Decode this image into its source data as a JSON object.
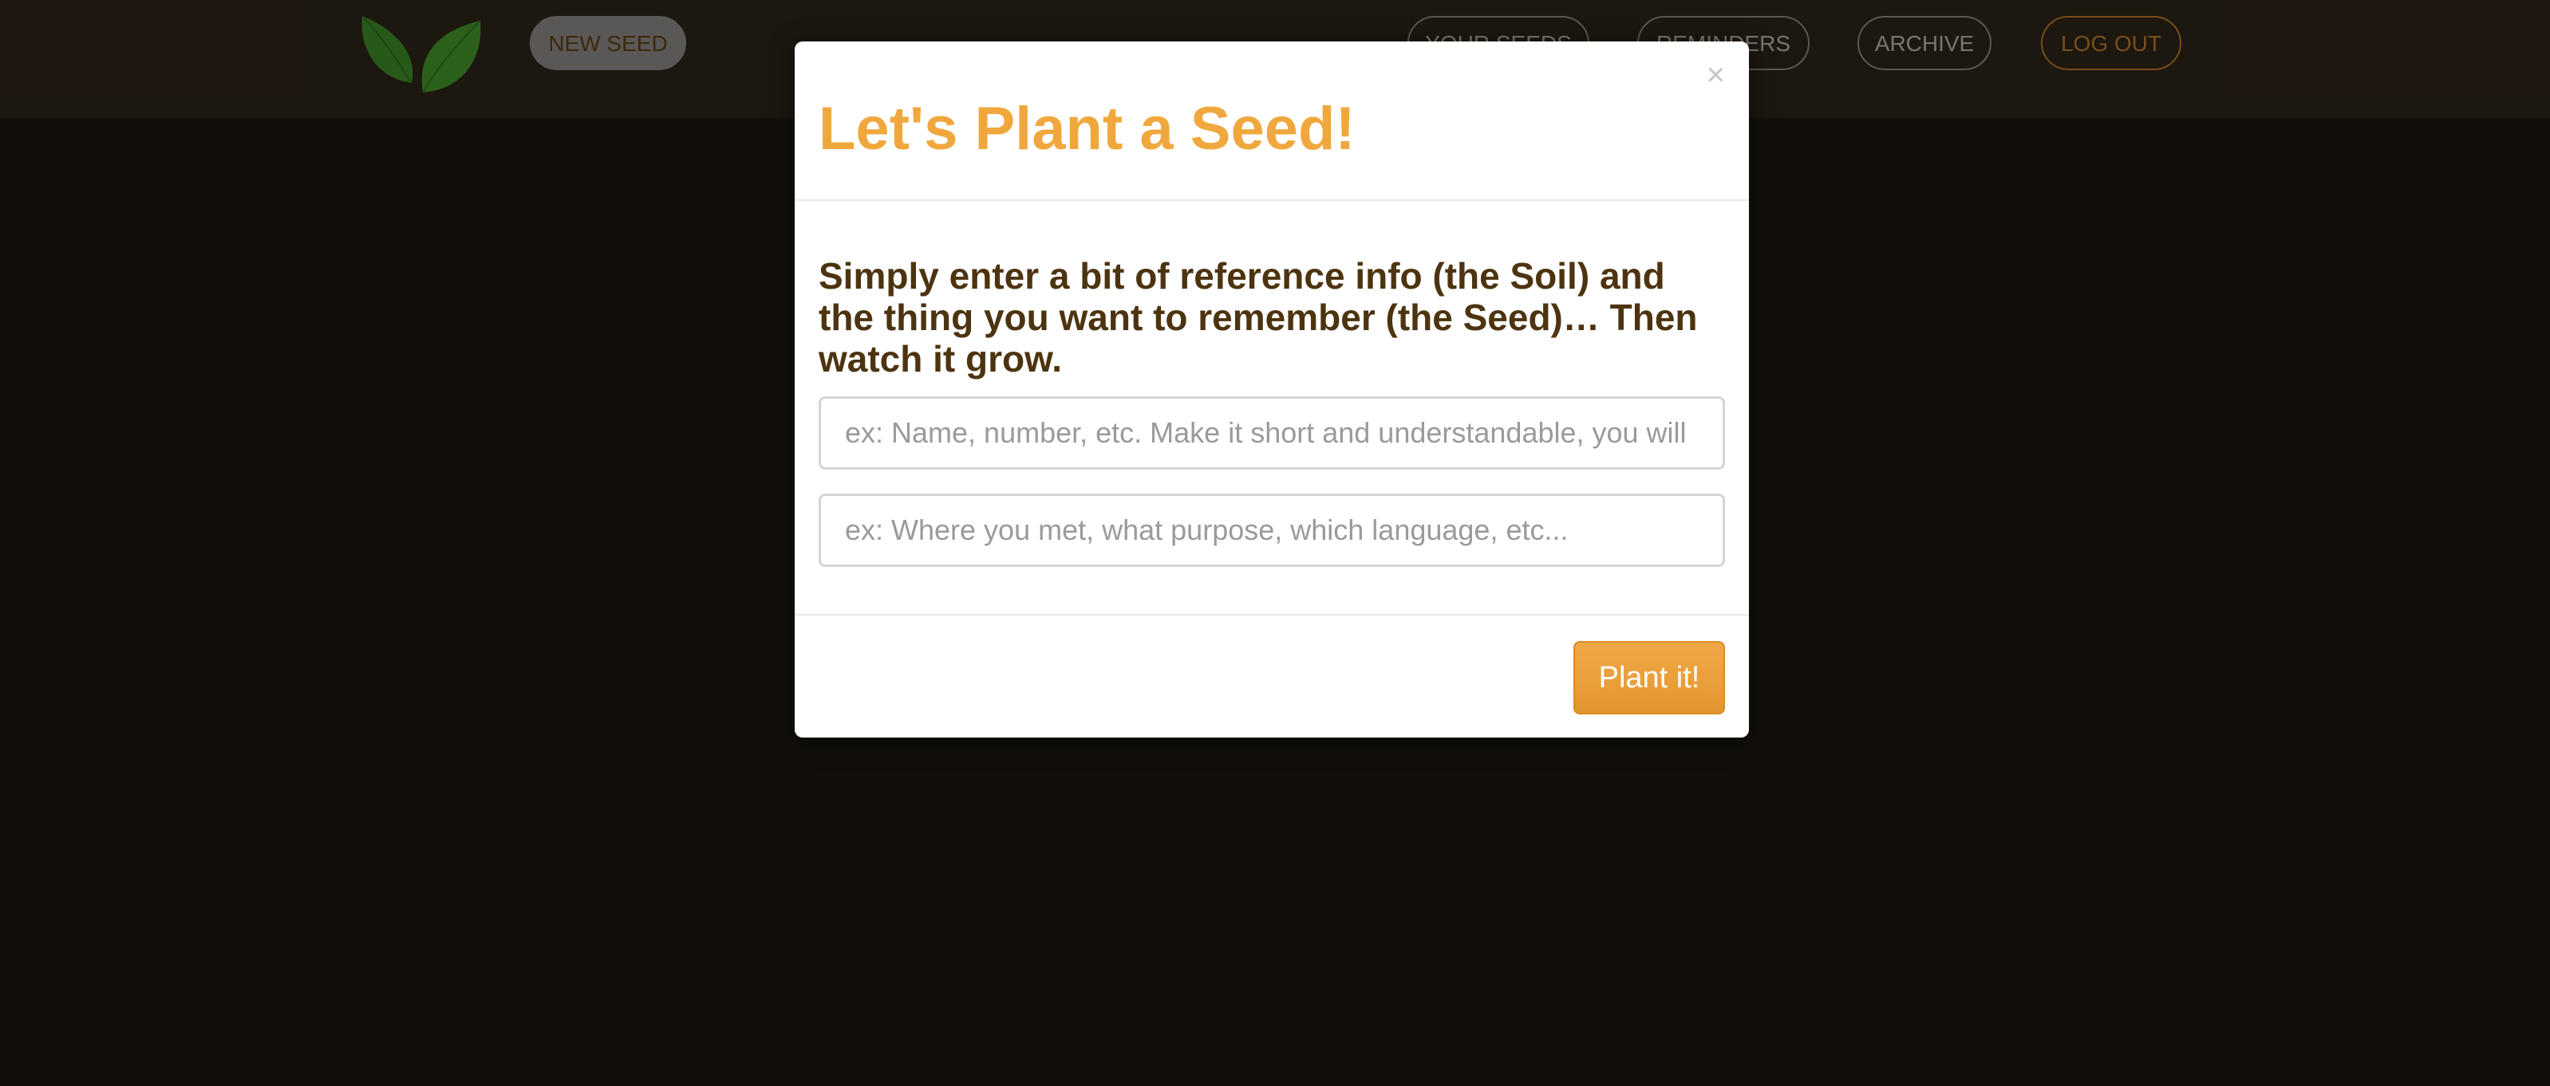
{
  "nav": {
    "logo": "leaf-logo-icon",
    "new_seed": "NEW SEED",
    "your_seeds": "YOUR SEEDS",
    "reminders": "REMINDERS",
    "archive": "ARCHIVE",
    "log_out": "LOG OUT"
  },
  "modal": {
    "close": "×",
    "title": "Let's Plant a Seed!",
    "intro": "Simply enter a bit of reference info (the Soil) and the thing you want to remember (the Seed)… Then watch it grow.",
    "soil_placeholder": "ex: Name, number, etc. Make it short and understandable, you will",
    "seed_placeholder": "ex: Where you met, what purpose, which language, etc...",
    "soil_value": "",
    "seed_value": "",
    "submit": "Plant it!"
  },
  "colors": {
    "accent": "#f0a83e",
    "text_dark": "#4d3410",
    "background": "#1c1711",
    "navbar": "#2c2418"
  }
}
